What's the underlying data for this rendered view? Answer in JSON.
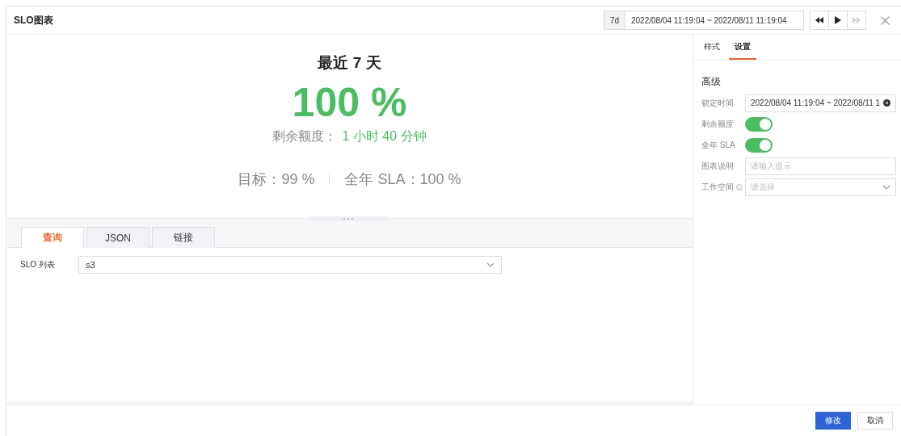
{
  "window": {
    "title": "SLO图表"
  },
  "time_range": {
    "preset": "7d",
    "value": "2022/08/04 11:19:04 ~ 2022/08/11 11:19:04"
  },
  "preview": {
    "title": "最近 7 天",
    "percent": "100 %",
    "remaining_label": "剩余额度：",
    "remaining_value": "1 小时 40 分钟",
    "target": "目标：99 %",
    "annual_sla": "全年 SLA：100 %"
  },
  "query_tabs": [
    {
      "label": "查询",
      "selected": true
    },
    {
      "label": "JSON",
      "selected": false
    },
    {
      "label": "链接",
      "selected": false
    }
  ],
  "slo_list": {
    "label": "SLO 列表",
    "value": "s3"
  },
  "settings_tabs": [
    {
      "label": "样式",
      "selected": false
    },
    {
      "label": "设置",
      "selected": true
    }
  ],
  "settings": {
    "heading": "高级",
    "rows": [
      {
        "kind": "input",
        "label": "锁定时间",
        "value": "2022/08/04 11:19:04 ~ 2022/08/11 1",
        "clearable": true
      },
      {
        "kind": "toggle",
        "label": "剩余额度",
        "on": true
      },
      {
        "kind": "toggle",
        "label": "全年 SLA",
        "on": true
      },
      {
        "kind": "input",
        "label": "图表说明",
        "placeholder": "请输入提示"
      },
      {
        "kind": "select",
        "label": "工作空间",
        "placeholder": "请选择",
        "info": true
      }
    ]
  },
  "buttons": [
    {
      "label": "修改",
      "kind": "primary"
    },
    {
      "label": "取消",
      "kind": "default"
    }
  ]
}
